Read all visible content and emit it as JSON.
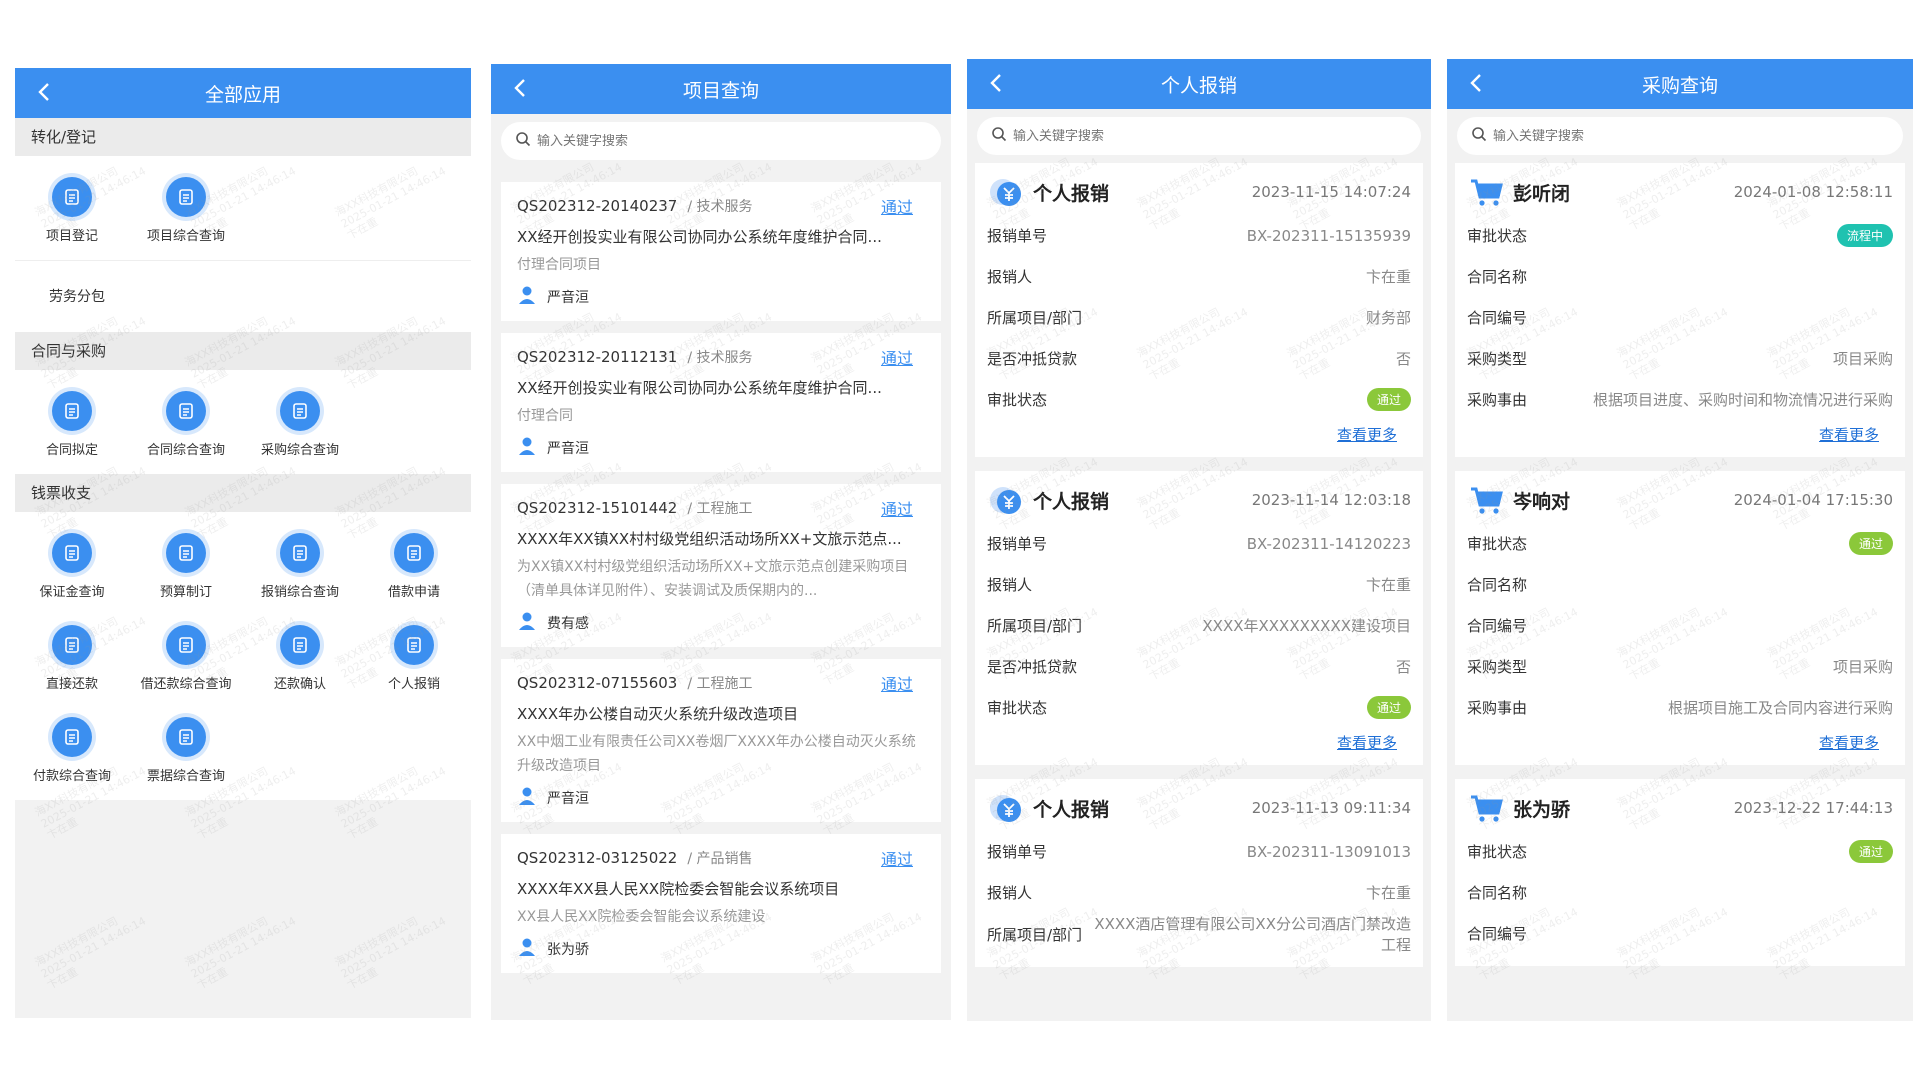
{
  "watermark": {
    "line1": "海XX科技有限公司",
    "line2": "2025-01-21 14:46:14",
    "line3": "卞在重"
  },
  "panel_all_apps": {
    "title": "全部应用",
    "sections": [
      {
        "title": "转化/登记",
        "apps": [
          {
            "label": "项目登记",
            "icon": "document-icon"
          },
          {
            "label": "项目综合查询",
            "icon": "copy-document-icon"
          }
        ]
      },
      {
        "plain": "劳务分包"
      },
      {
        "title": "合同与采购",
        "apps": [
          {
            "label": "合同拟定",
            "icon": "contract-pen-icon"
          },
          {
            "label": "合同综合查询",
            "icon": "contract-search-icon"
          },
          {
            "label": "采购综合查询",
            "icon": "purchase-search-icon"
          }
        ]
      },
      {
        "title": "钱票收支",
        "apps": [
          {
            "label": "保证金查询",
            "icon": "deposit-search-icon"
          },
          {
            "label": "预算制订",
            "icon": "budget-icon"
          },
          {
            "label": "报销综合查询",
            "icon": "reimburse-search-icon"
          },
          {
            "label": "借款申请",
            "icon": "loan-hand-icon"
          },
          {
            "label": "直接还款",
            "icon": "repay-card-icon"
          },
          {
            "label": "借还款综合查询",
            "icon": "loan-search-icon"
          },
          {
            "label": "还款确认",
            "icon": "repay-confirm-icon"
          },
          {
            "label": "个人报销",
            "icon": "personal-reimburse-icon"
          },
          {
            "label": "付款综合查询",
            "icon": "payment-search-icon"
          },
          {
            "label": "票据综合查询",
            "icon": "bill-search-icon"
          }
        ]
      }
    ]
  },
  "panel_projects": {
    "title": "项目查询",
    "search_placeholder": "输入关键字搜索",
    "cards": [
      {
        "code": "QS202312-20140237",
        "category": "/ 技术服务",
        "status": "通过",
        "title": "XX经开创投实业有限公司协同办公系统年度维护合同...",
        "desc": "付理合同项目",
        "user": "严音洹"
      },
      {
        "code": "QS202312-20112131",
        "category": "/ 技术服务",
        "status": "通过",
        "title": "XX经开创投实业有限公司协同办公系统年度维护合同...",
        "desc": "付理合同",
        "user": "严音洹"
      },
      {
        "code": "QS202312-15101442",
        "category": "/ 工程施工",
        "status": "通过",
        "title": "XXXX年XX镇XX村村级党组织活动场所XX+文旅示范点...",
        "desc": "为XX镇XX村村级党组织活动场所XX+文旅示范点创建采购项目（清单具体详见附件）、安装调试及质保期内的...",
        "user": "费有感"
      },
      {
        "code": "QS202312-07155603",
        "category": "/ 工程施工",
        "status": "通过",
        "title": "XXXX年办公楼自动灭火系统升级改造项目",
        "desc": "XX中烟工业有限责任公司XX卷烟厂XXXX年办公楼自动灭火系统升级改造项目",
        "user": "严音洹"
      },
      {
        "code": "QS202312-03125022",
        "category": "/ 产品销售",
        "status": "通过",
        "title": "XXXX年XX县人民XX院检委会智能会议系统项目",
        "desc": "XX县人民XX院检委会智能会议系统建设",
        "user": "张为骄"
      }
    ]
  },
  "panel_reimburse": {
    "title": "个人报销",
    "search_placeholder": "输入关键字搜索",
    "more_label": "查看更多",
    "cards": [
      {
        "name": "个人报销",
        "time": "2023-11-15 14:07:24",
        "rows": [
          [
            "报销单号",
            "BX-202311-15135939"
          ],
          [
            "报销人",
            "卞在重"
          ],
          [
            "所属项目/部门",
            "财务部"
          ],
          [
            "是否冲抵贷款",
            "否"
          ]
        ],
        "status_label": "审批状态",
        "status": "通过"
      },
      {
        "name": "个人报销",
        "time": "2023-11-14 12:03:18",
        "rows": [
          [
            "报销单号",
            "BX-202311-14120223"
          ],
          [
            "报销人",
            "卞在重"
          ],
          [
            "所属项目/部门",
            "XXXX年XXXXXXXXX建设项目"
          ],
          [
            "是否冲抵贷款",
            "否"
          ]
        ],
        "status_label": "审批状态",
        "status": "通过"
      },
      {
        "name": "个人报销",
        "time": "2023-11-13 09:11:34",
        "rows": [
          [
            "报销单号",
            "BX-202311-13091013"
          ],
          [
            "报销人",
            "卞在重"
          ],
          [
            "所属项目/部门",
            "XXXX酒店管理有限公司XX分公司酒店门禁改造工程"
          ]
        ]
      }
    ]
  },
  "panel_purchase": {
    "title": "采购查询",
    "search_placeholder": "输入关键字搜索",
    "more_label": "查看更多",
    "cards": [
      {
        "name": "彭听闭",
        "time": "2024-01-08 12:58:11",
        "status_label": "审批状态",
        "status": "流程中",
        "rows": [
          [
            "合同名称",
            ""
          ],
          [
            "合同编号",
            ""
          ],
          [
            "采购类型",
            "项目采购"
          ],
          [
            "采购事由",
            "根据项目进度、采购时间和物流情况进行采购"
          ]
        ]
      },
      {
        "name": "岑响对",
        "time": "2024-01-04 17:15:30",
        "status_label": "审批状态",
        "status": "通过",
        "rows": [
          [
            "合同名称",
            ""
          ],
          [
            "合同编号",
            ""
          ],
          [
            "采购类型",
            "项目采购"
          ],
          [
            "采购事由",
            "根据项目施工及合同内容进行采购"
          ]
        ]
      },
      {
        "name": "张为骄",
        "time": "2023-12-22 17:44:13",
        "status_label": "审批状态",
        "status": "通过",
        "rows": [
          [
            "合同名称",
            ""
          ],
          [
            "合同编号",
            ""
          ]
        ]
      }
    ]
  }
}
